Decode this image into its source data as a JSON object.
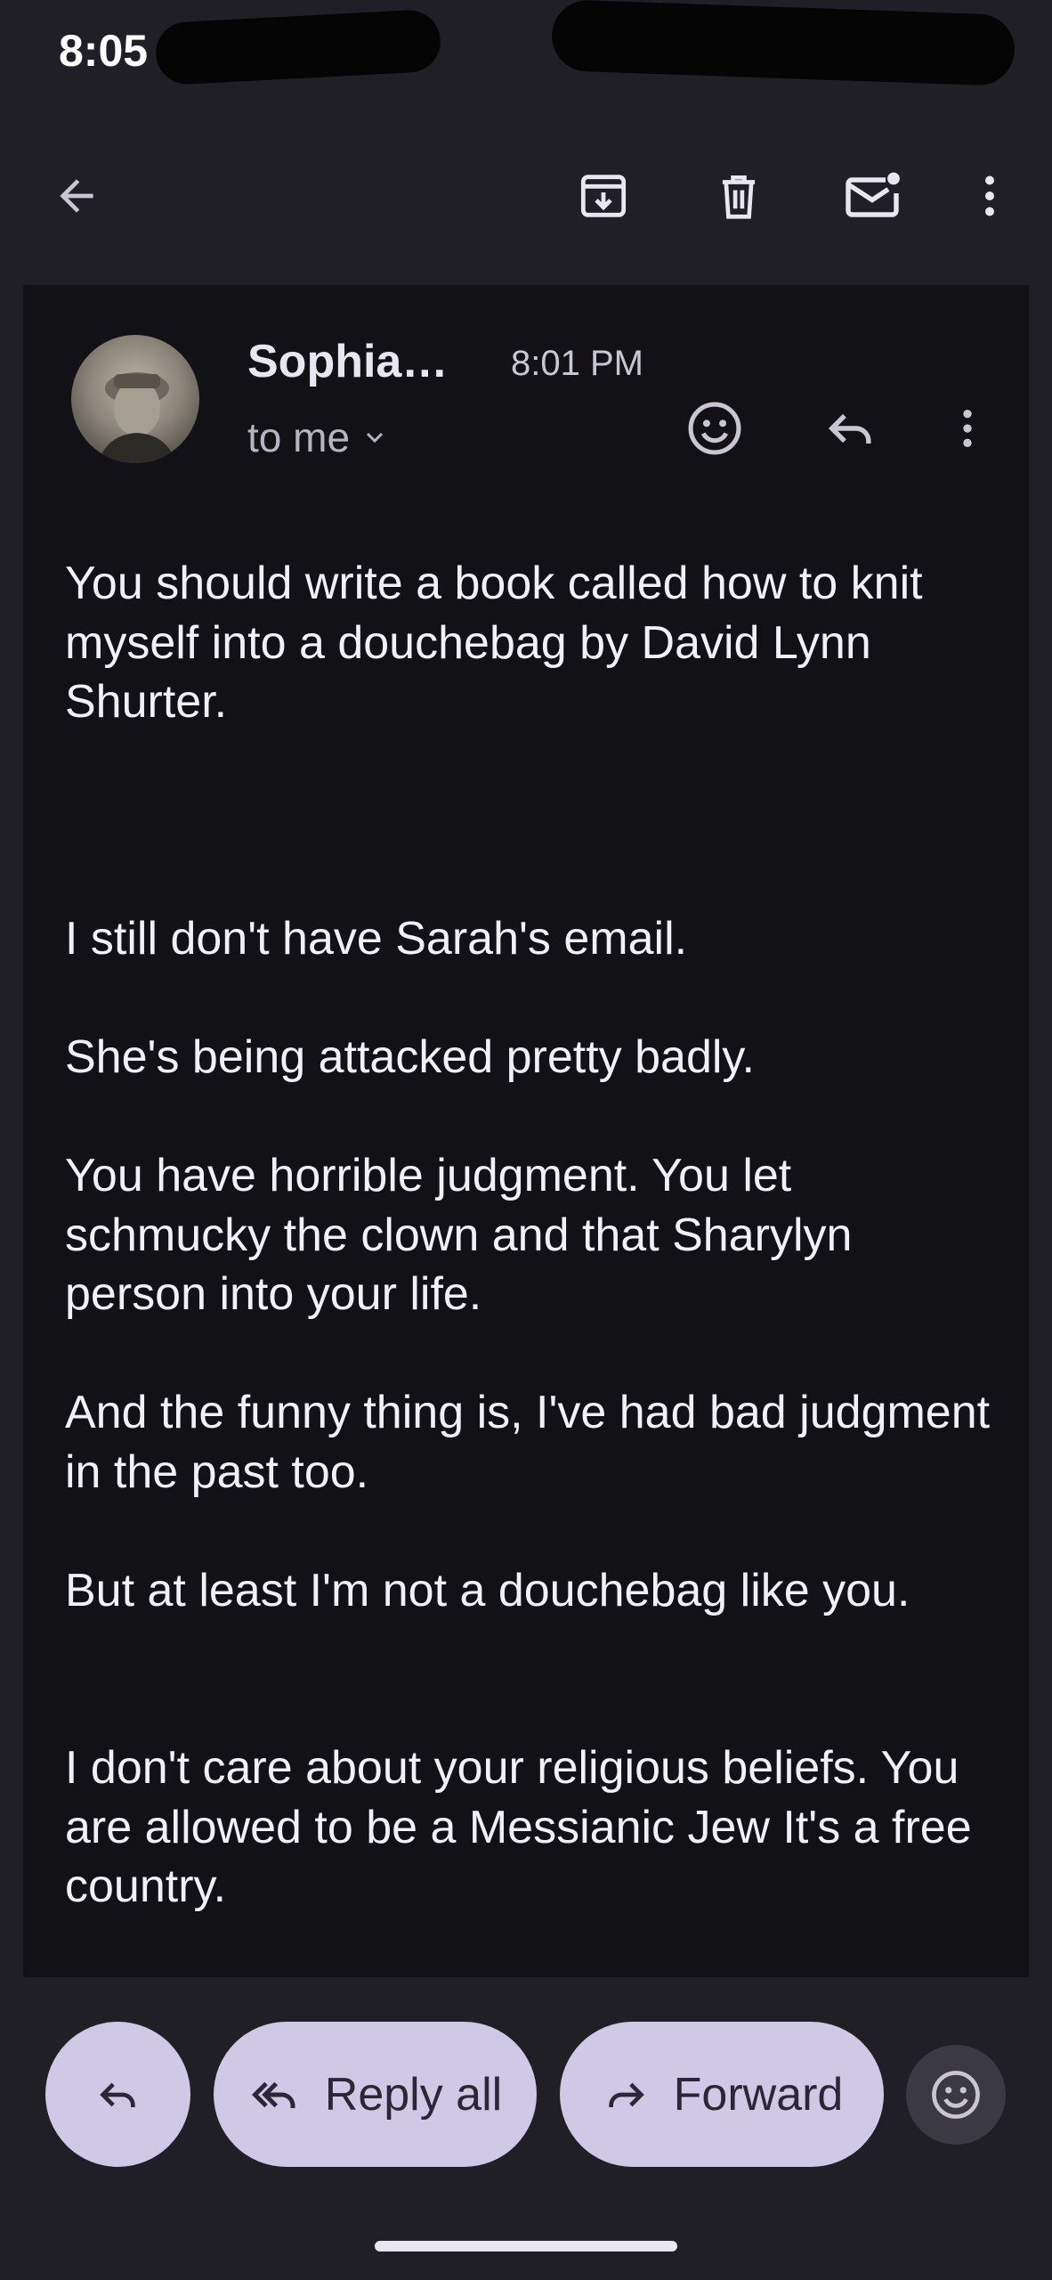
{
  "status_bar": {
    "time": "8:05"
  },
  "toolbar": {
    "icons": [
      "back-arrow-icon",
      "archive-icon",
      "delete-icon",
      "mark-unread-icon",
      "more-vert-icon"
    ]
  },
  "email": {
    "sender_name": "Sophia…",
    "time": "8:01 PM",
    "recipient_label": "to me",
    "paragraphs": [
      "You should write a book called how to knit myself into a douchebag by David Lynn Shurter.",
      "",
      "",
      "I still don't have Sarah's email.",
      "She's being attacked pretty badly.",
      "You have horrible judgment. You let schmucky the clown and that Sharylyn person into your life.",
      "And the funny thing is, I've had bad judgment in the past too.",
      "But at least I'm not a douchebag like you.",
      "",
      "I don't care about your religious beliefs. You are allowed to be a Messianic Jew It's a free country."
    ]
  },
  "actions": {
    "reply_all_label": "Reply all",
    "forward_label": "Forward"
  },
  "colors": {
    "background": "#1f1f25",
    "card": "#121116",
    "pill": "#cfc9e6"
  }
}
